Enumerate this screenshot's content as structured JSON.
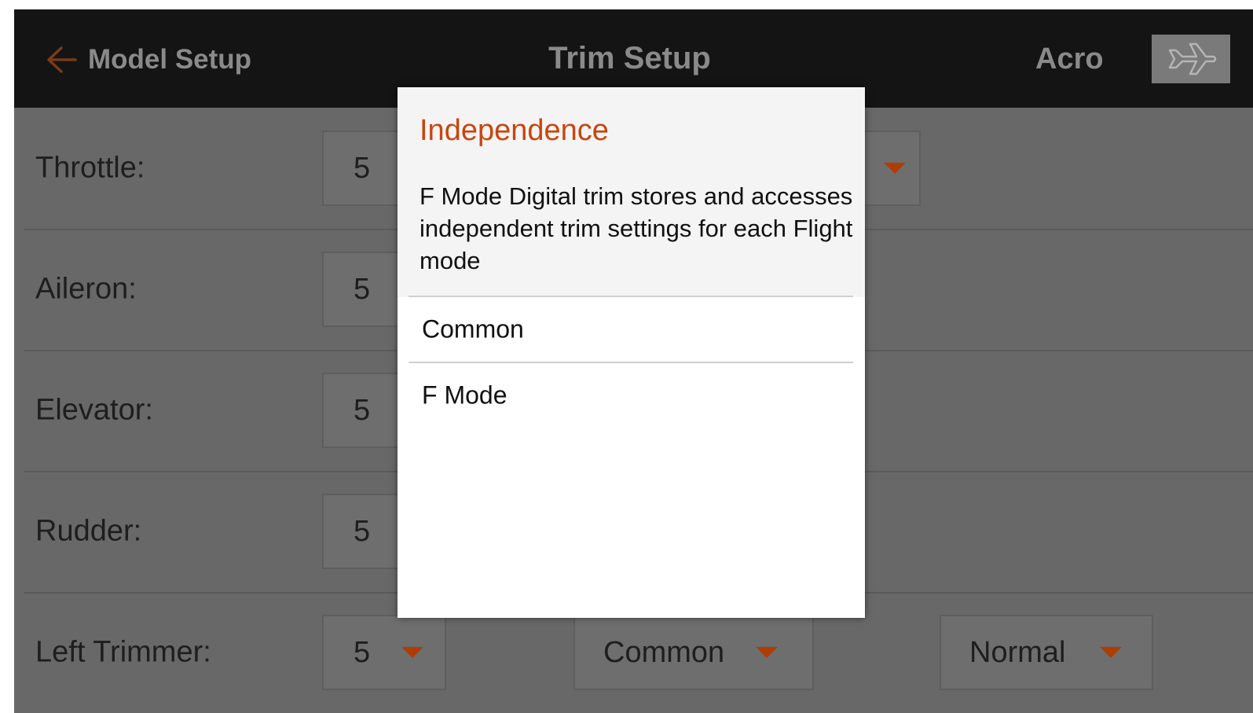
{
  "header": {
    "back_label": "Model Setup",
    "title": "Trim Setup",
    "flight_mode": "Acro",
    "back_icon": "left-arrow-icon",
    "model_icon": "airplane-icon"
  },
  "rows": [
    {
      "label": "Throttle:",
      "step": "5"
    },
    {
      "label": "Aileron:",
      "step": "5"
    },
    {
      "label": "Elevator:",
      "step": "5"
    },
    {
      "label": "Rudder:",
      "step": "5"
    },
    {
      "label": "Left Trimmer:",
      "step": "5",
      "type": "Common",
      "direction": "Normal"
    }
  ],
  "dialog": {
    "title": "Independence",
    "description": "F Mode Digital trim stores and accesses independent trim settings for each Flight mode",
    "options": [
      "Common",
      "F Mode"
    ]
  },
  "colors": {
    "accent": "#c8460e",
    "caret": "#b03c00",
    "topbar": "#141414",
    "dimmed_background": "#686868"
  }
}
